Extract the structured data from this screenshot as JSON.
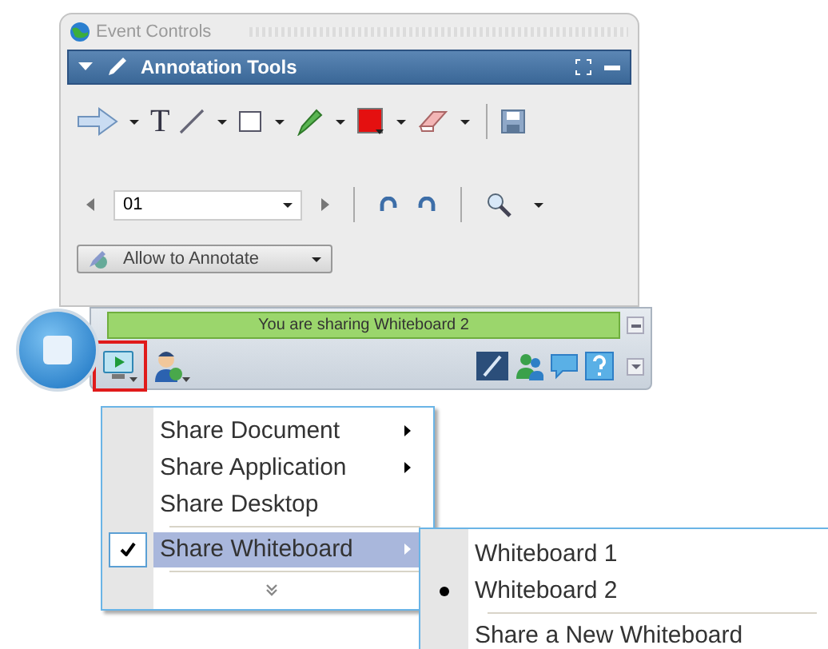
{
  "window": {
    "title": "Event Controls"
  },
  "annotation_panel": {
    "title": "Annotation Tools",
    "text_tool": "T",
    "page": {
      "value": "01"
    },
    "allow_button": "Allow to Annotate"
  },
  "status": "You are sharing Whiteboard 2",
  "share_button": {
    "highlighted": true
  },
  "menu": {
    "items": [
      {
        "kind": "item",
        "label": "Share Document",
        "submenu": true,
        "checked": false,
        "selected": false
      },
      {
        "kind": "item",
        "label": "Share Application",
        "submenu": true,
        "checked": false,
        "selected": false
      },
      {
        "kind": "item",
        "label": "Share Desktop",
        "submenu": false,
        "checked": false,
        "selected": false
      },
      {
        "kind": "separator"
      },
      {
        "kind": "item",
        "label": "Share Whiteboard",
        "submenu": true,
        "checked": true,
        "selected": true
      },
      {
        "kind": "separator"
      },
      {
        "kind": "more"
      }
    ]
  },
  "submenu": {
    "items": [
      {
        "kind": "item",
        "label": "Whiteboard 1",
        "selected": false
      },
      {
        "kind": "item",
        "label": "Whiteboard 2",
        "selected": true
      },
      {
        "kind": "separator"
      },
      {
        "kind": "item",
        "label": "Share a New Whiteboard",
        "selected": false
      }
    ]
  }
}
